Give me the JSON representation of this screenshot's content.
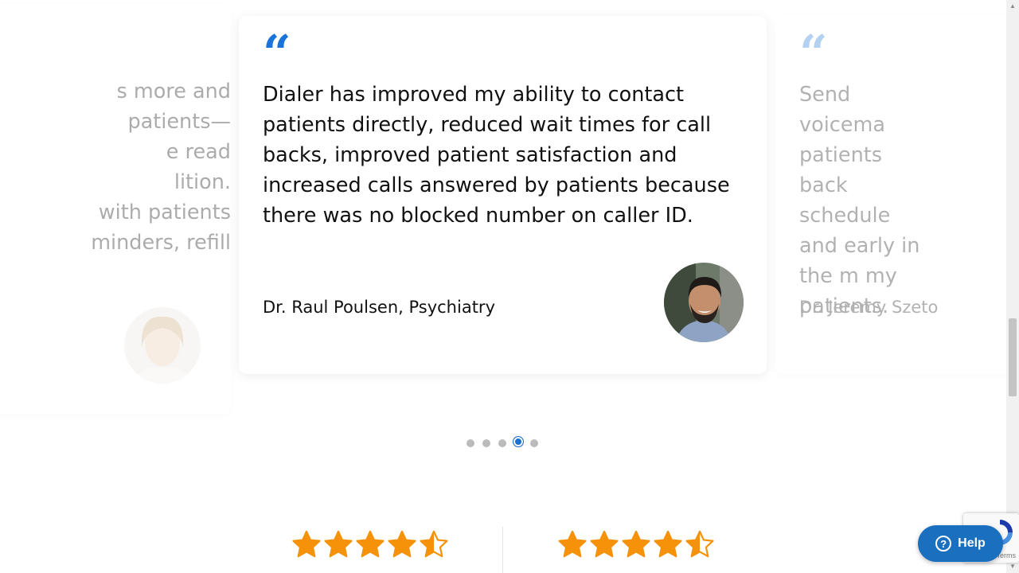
{
  "testimonials": {
    "previous": {
      "quote_lines": [
        "s more and",
        "patients—",
        "e read",
        "lition.",
        "with patients",
        "minders, refill"
      ]
    },
    "current": {
      "quote_mark": "“",
      "quote": "Dialer has improved my ability to contact patients directly, reduced wait times for call backs, improved patient satisfaction and increased calls answered by patients because there was no blocked number on caller ID.",
      "author": "Dr. Raul Poulsen, Psychiatry"
    },
    "next": {
      "quote_mark": "“",
      "quote": "Send voicema patients back schedule and early in the m my patients.",
      "author": "Dr. Jeremy Szeto"
    }
  },
  "carousel": {
    "dot_count": 5,
    "active_index": 3
  },
  "ratings": [
    {
      "stars": 4.5
    },
    {
      "stars": 4.5
    }
  ],
  "help_button": {
    "label": "Help",
    "icon": "question-icon"
  },
  "recaptcha": {
    "terms_label": "Terms"
  },
  "colors": {
    "accent": "#1a73d9",
    "star": "#f5920a",
    "help_bg": "#1a6fbf"
  }
}
